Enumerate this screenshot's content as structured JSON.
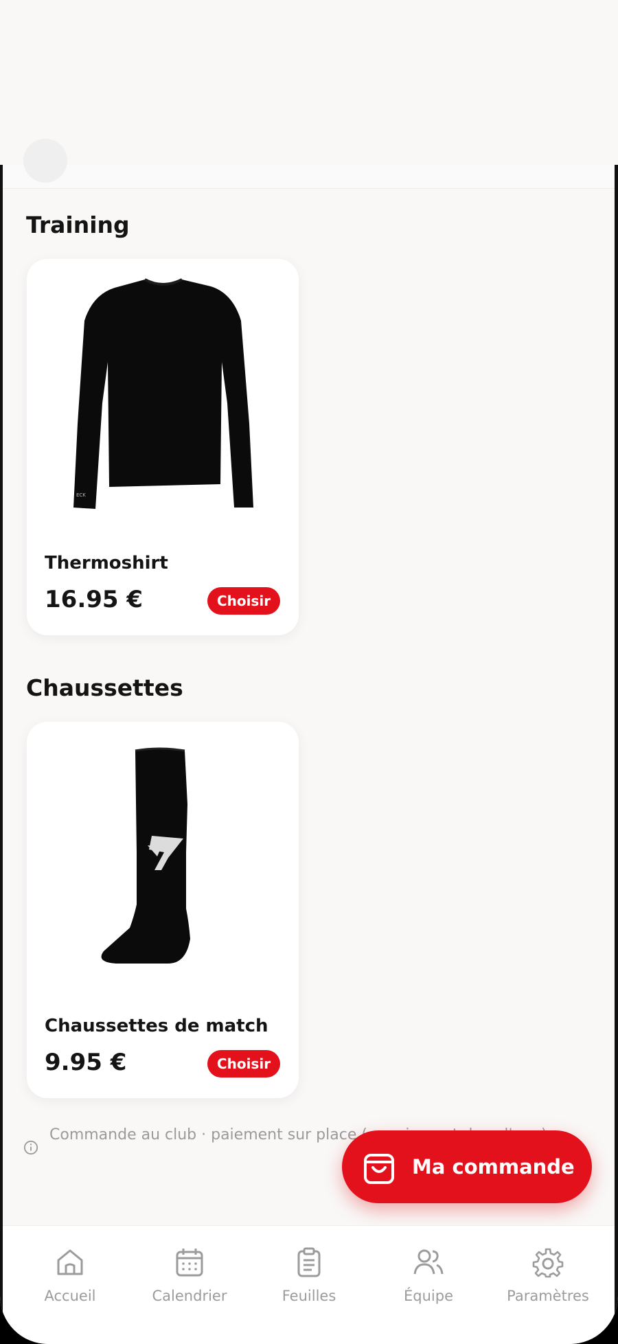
{
  "sections": [
    {
      "title": "Training",
      "product": {
        "name": "Thermoshirt",
        "price": "16.95 €",
        "button": "Choisir",
        "image": "black-long-sleeve-thermoshirt"
      }
    },
    {
      "title": "Chaussettes",
      "product": {
        "name": "Chaussettes de match",
        "price": "9.95 €",
        "button": "Choisir",
        "image": "black-football-sock"
      }
    }
  ],
  "notice": {
    "icon": "info-icon",
    "text": "Commande au club · paiement sur place (... paiement dans l'app)."
  },
  "fab": {
    "label": "Ma commande",
    "icon": "shopping-bag-icon"
  },
  "nav": [
    {
      "label": "Accueil",
      "icon": "home-icon"
    },
    {
      "label": "Calendrier",
      "icon": "calendar-icon"
    },
    {
      "label": "Feuilles",
      "icon": "clipboard-icon"
    },
    {
      "label": "Équipe",
      "icon": "team-icon"
    },
    {
      "label": "Paramètres",
      "icon": "gear-icon"
    }
  ],
  "colors": {
    "accent": "#e2111b",
    "background": "#f9f8f7",
    "text": "#141414",
    "muted": "#9b9b9b"
  }
}
